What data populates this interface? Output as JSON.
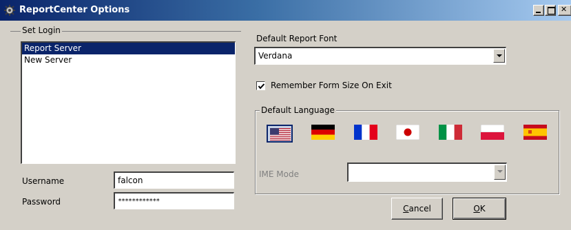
{
  "window": {
    "title": "ReportCenter Options"
  },
  "set_login": {
    "group_label": "Set Login",
    "servers": [
      {
        "label": "Report Server",
        "selected": true
      },
      {
        "label": "New Server",
        "selected": false
      }
    ],
    "username_label": "Username",
    "username_value": "falcon",
    "password_label": "Password",
    "password_value": "************"
  },
  "report_font": {
    "label": "Default Report Font",
    "selected": "Verdana"
  },
  "remember_form": {
    "label": "Remember Form Size On Exit",
    "checked": true
  },
  "language": {
    "group_label": "Default Language",
    "flags": [
      {
        "name": "usa",
        "selected": true
      },
      {
        "name": "germany",
        "selected": false
      },
      {
        "name": "france",
        "selected": false
      },
      {
        "name": "japan",
        "selected": false
      },
      {
        "name": "italy",
        "selected": false
      },
      {
        "name": "poland",
        "selected": false
      },
      {
        "name": "spain",
        "selected": false
      }
    ],
    "ime_label": "IME Mode",
    "ime_value": ""
  },
  "buttons": {
    "cancel_first": "C",
    "cancel_rest": "ancel",
    "ok_first": "O",
    "ok_rest": "K"
  },
  "colors": {
    "title_start": "#0a246a",
    "title_end": "#a6caf0",
    "selection": "#0a246a",
    "face": "#d4d0c8"
  }
}
